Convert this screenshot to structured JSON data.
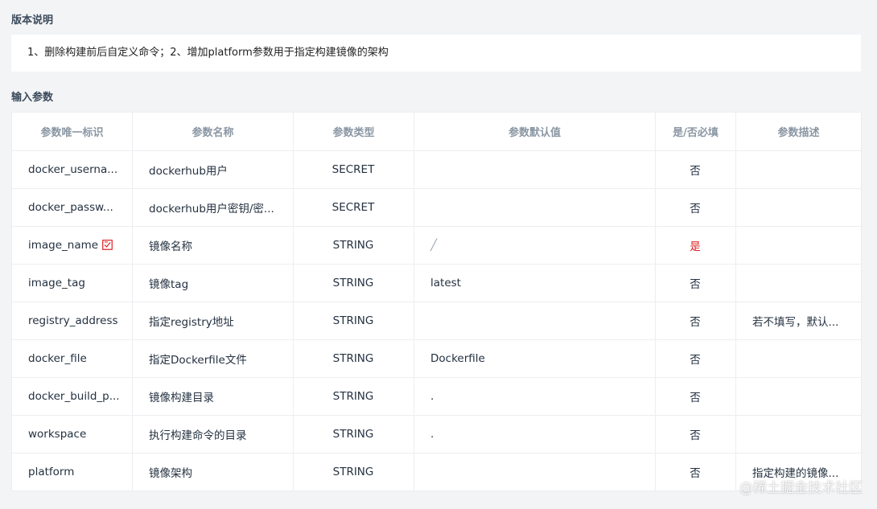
{
  "version_section": {
    "title": "版本说明",
    "content": "1、删除构建前后自定义命令；2、增加platform参数用于指定构建镜像的架构"
  },
  "params_section": {
    "title": "输入参数",
    "headers": [
      "参数唯一标识",
      "参数名称",
      "参数类型",
      "参数默认值",
      "是/否必填",
      "参数描述"
    ],
    "rows": [
      {
        "id": "docker_userna...",
        "name": "dockerhub用户",
        "type": "SECRET",
        "default": "",
        "required": "否",
        "desc": ""
      },
      {
        "id": "docker_passw...",
        "name": "dockerhub用户密钥/密...",
        "type": "SECRET",
        "default": "",
        "required": "否",
        "desc": ""
      },
      {
        "id": "image_name",
        "name": "镜像名称",
        "type": "STRING",
        "default": "╱",
        "required": "是",
        "desc": ""
      },
      {
        "id": "image_tag",
        "name": "镜像tag",
        "type": "STRING",
        "default": "latest",
        "required": "否",
        "desc": ""
      },
      {
        "id": "registry_address",
        "name": "指定registry地址",
        "type": "STRING",
        "default": "",
        "required": "否",
        "desc": "若不填写，默认..."
      },
      {
        "id": "docker_file",
        "name": "指定Dockerfile文件",
        "type": "STRING",
        "default": "Dockerfile",
        "required": "否",
        "desc": ""
      },
      {
        "id": "docker_build_p...",
        "name": "镜像构建目录",
        "type": "STRING",
        "default": ".",
        "required": "否",
        "desc": ""
      },
      {
        "id": "workspace",
        "name": "执行构建命令的目录",
        "type": "STRING",
        "default": ".",
        "required": "否",
        "desc": ""
      },
      {
        "id": "platform",
        "name": "镜像架构",
        "type": "STRING",
        "default": "",
        "required": "否",
        "desc": "指定构建的镜像..."
      }
    ]
  },
  "watermark": "@稀土掘金技术社区",
  "colors": {
    "required_yes": "#e02020",
    "background": "#f3f4f6",
    "icon": "#e02020"
  },
  "icons": {
    "image_name_note": "edit-note-icon"
  }
}
